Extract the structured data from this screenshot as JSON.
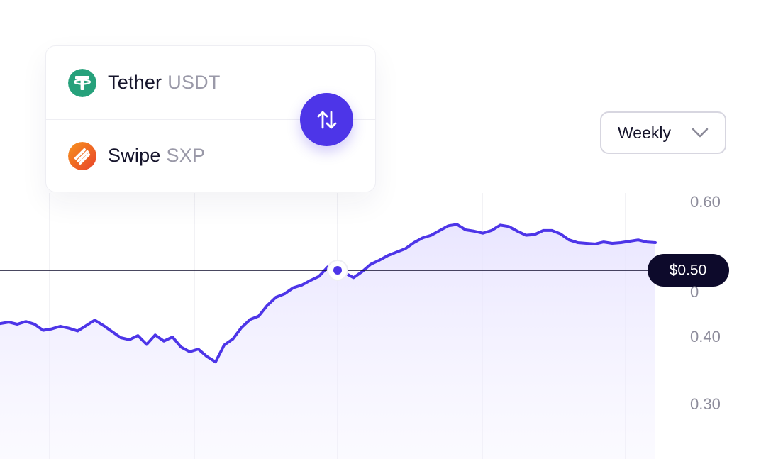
{
  "pair": {
    "from": {
      "name": "Tether",
      "symbol": "USDT",
      "color": "#26a17b",
      "icon": "tether-icon"
    },
    "to": {
      "name": "Swipe",
      "symbol": "SXP",
      "color": "#f15a29",
      "icon": "swipe-icon"
    },
    "swap_icon": "swap-arrows-icon"
  },
  "period_select": {
    "value": "Weekly",
    "icon": "chevron-down-icon"
  },
  "chart_data": {
    "type": "area",
    "accent": "#4d35e8",
    "y_ticks": [
      "0.60",
      "0",
      "0.40",
      "0.30"
    ],
    "ylim": [
      0.3,
      0.6
    ],
    "crosshair": {
      "value": 0.5,
      "label": "$0.50"
    },
    "grid": true,
    "y": [
      0.421,
      0.423,
      0.42,
      0.424,
      0.42,
      0.411,
      0.413,
      0.417,
      0.414,
      0.41,
      0.418,
      0.426,
      0.418,
      0.409,
      0.4,
      0.397,
      0.403,
      0.39,
      0.404,
      0.395,
      0.401,
      0.386,
      0.379,
      0.383,
      0.372,
      0.364,
      0.389,
      0.398,
      0.415,
      0.427,
      0.432,
      0.448,
      0.46,
      0.465,
      0.474,
      0.478,
      0.485,
      0.491,
      0.505,
      0.501,
      0.496,
      0.489,
      0.498,
      0.509,
      0.515,
      0.522,
      0.527,
      0.532,
      0.541,
      0.548,
      0.552,
      0.559,
      0.566,
      0.568,
      0.56,
      0.558,
      0.555,
      0.559,
      0.567,
      0.565,
      0.558,
      0.552,
      0.553,
      0.559,
      0.559,
      0.554,
      0.545,
      0.541,
      0.54,
      0.539,
      0.542,
      0.54,
      0.541,
      0.543,
      0.545,
      0.542,
      0.541
    ]
  }
}
